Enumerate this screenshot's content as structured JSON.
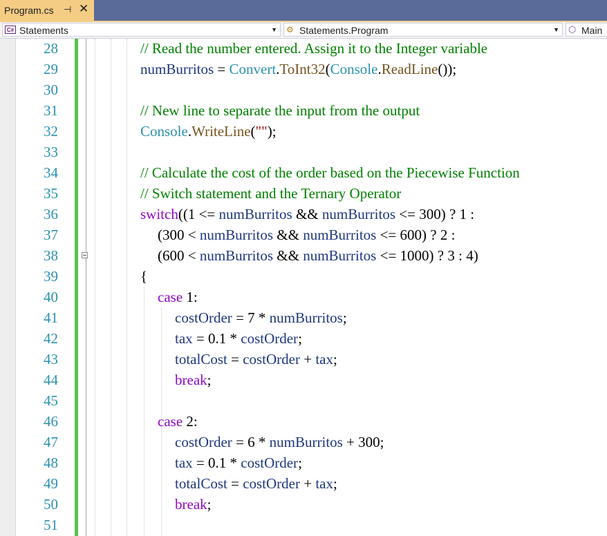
{
  "tab": {
    "title": "Program.cs",
    "pin_glyph": "⊣",
    "close_glyph": "✕"
  },
  "nav": {
    "project": "Statements",
    "type": "Statements.Program",
    "member": "Main"
  },
  "colors": {
    "tab_active": "#f5cc84",
    "tab_strip": "#5a6a99",
    "line_number": "#2b91af",
    "comment": "#008000",
    "keyword_control": "#8f08c4",
    "type": "#2b91af",
    "method": "#74531f",
    "string": "#a31515",
    "identifier": "#1f377f",
    "change_bar": "#57c34a"
  },
  "lines": [
    {
      "n": "28",
      "indent": 0,
      "tokens": [
        {
          "t": "// Read the number entered. Assign it to the Integer variable",
          "k": "comment"
        }
      ]
    },
    {
      "n": "29",
      "indent": 0,
      "tokens": [
        {
          "t": "numBurritos",
          "k": "ident"
        },
        {
          "t": " = ",
          "k": "plain"
        },
        {
          "t": "Convert",
          "k": "type"
        },
        {
          "t": ".",
          "k": "plain"
        },
        {
          "t": "ToInt32",
          "k": "method"
        },
        {
          "t": "(",
          "k": "plain"
        },
        {
          "t": "Console",
          "k": "type"
        },
        {
          "t": ".",
          "k": "plain"
        },
        {
          "t": "ReadLine",
          "k": "method"
        },
        {
          "t": "());",
          "k": "plain"
        }
      ]
    },
    {
      "n": "30",
      "indent": 0,
      "tokens": []
    },
    {
      "n": "31",
      "indent": 0,
      "tokens": [
        {
          "t": "// New line to separate the input from the output",
          "k": "comment"
        }
      ]
    },
    {
      "n": "32",
      "indent": 0,
      "tokens": [
        {
          "t": "Console",
          "k": "type"
        },
        {
          "t": ".",
          "k": "plain"
        },
        {
          "t": "WriteLine",
          "k": "method"
        },
        {
          "t": "(",
          "k": "plain"
        },
        {
          "t": "\"\"",
          "k": "string"
        },
        {
          "t": ");",
          "k": "plain"
        }
      ]
    },
    {
      "n": "33",
      "indent": 0,
      "tokens": []
    },
    {
      "n": "34",
      "indent": 0,
      "tokens": [
        {
          "t": "// Calculate the cost of the order based on the Piecewise Function",
          "k": "comment"
        }
      ]
    },
    {
      "n": "35",
      "indent": 0,
      "tokens": [
        {
          "t": "// Switch statement and the Ternary Operator",
          "k": "comment"
        }
      ]
    },
    {
      "n": "36",
      "indent": 0,
      "tokens": [
        {
          "t": "switch",
          "k": "control"
        },
        {
          "t": "((1 <= ",
          "k": "plain"
        },
        {
          "t": "numBurritos",
          "k": "ident"
        },
        {
          "t": " && ",
          "k": "plain"
        },
        {
          "t": "numBurritos",
          "k": "ident"
        },
        {
          "t": " <= 300) ? 1 :",
          "k": "plain"
        }
      ]
    },
    {
      "n": "37",
      "indent": 1,
      "tokens": [
        {
          "t": "(300 < ",
          "k": "plain"
        },
        {
          "t": "numBurritos",
          "k": "ident"
        },
        {
          "t": " && ",
          "k": "plain"
        },
        {
          "t": "numBurritos",
          "k": "ident"
        },
        {
          "t": " <= 600) ? 2 :",
          "k": "plain"
        }
      ]
    },
    {
      "n": "38",
      "indent": 1,
      "tokens": [
        {
          "t": "(600 < ",
          "k": "plain"
        },
        {
          "t": "numBurritos",
          "k": "ident"
        },
        {
          "t": " && ",
          "k": "plain"
        },
        {
          "t": "numBurritos",
          "k": "ident"
        },
        {
          "t": " <= 1000) ? 3 : 4)",
          "k": "plain"
        }
      ]
    },
    {
      "n": "39",
      "indent": 0,
      "tokens": [
        {
          "t": "{",
          "k": "plain"
        }
      ]
    },
    {
      "n": "40",
      "indent": 1,
      "tokens": [
        {
          "t": "case",
          "k": "control"
        },
        {
          "t": " 1:",
          "k": "plain"
        }
      ]
    },
    {
      "n": "41",
      "indent": 2,
      "tokens": [
        {
          "t": "costOrder",
          "k": "ident"
        },
        {
          "t": " = 7 * ",
          "k": "plain"
        },
        {
          "t": "numBurritos",
          "k": "ident"
        },
        {
          "t": ";",
          "k": "plain"
        }
      ]
    },
    {
      "n": "42",
      "indent": 2,
      "tokens": [
        {
          "t": "tax",
          "k": "ident"
        },
        {
          "t": " = 0.1 * ",
          "k": "plain"
        },
        {
          "t": "costOrder",
          "k": "ident"
        },
        {
          "t": ";",
          "k": "plain"
        }
      ]
    },
    {
      "n": "43",
      "indent": 2,
      "tokens": [
        {
          "t": "totalCost",
          "k": "ident"
        },
        {
          "t": " = ",
          "k": "plain"
        },
        {
          "t": "costOrder",
          "k": "ident"
        },
        {
          "t": " + ",
          "k": "plain"
        },
        {
          "t": "tax",
          "k": "ident"
        },
        {
          "t": ";",
          "k": "plain"
        }
      ]
    },
    {
      "n": "44",
      "indent": 2,
      "tokens": [
        {
          "t": "break",
          "k": "control"
        },
        {
          "t": ";",
          "k": "plain"
        }
      ]
    },
    {
      "n": "45",
      "indent": 0,
      "tokens": []
    },
    {
      "n": "46",
      "indent": 1,
      "tokens": [
        {
          "t": "case",
          "k": "control"
        },
        {
          "t": " 2:",
          "k": "plain"
        }
      ]
    },
    {
      "n": "47",
      "indent": 2,
      "tokens": [
        {
          "t": "costOrder",
          "k": "ident"
        },
        {
          "t": " = 6 * ",
          "k": "plain"
        },
        {
          "t": "numBurritos",
          "k": "ident"
        },
        {
          "t": " + 300;",
          "k": "plain"
        }
      ]
    },
    {
      "n": "48",
      "indent": 2,
      "tokens": [
        {
          "t": "tax",
          "k": "ident"
        },
        {
          "t": " = 0.1 * ",
          "k": "plain"
        },
        {
          "t": "costOrder",
          "k": "ident"
        },
        {
          "t": ";",
          "k": "plain"
        }
      ]
    },
    {
      "n": "49",
      "indent": 2,
      "tokens": [
        {
          "t": "totalCost",
          "k": "ident"
        },
        {
          "t": " = ",
          "k": "plain"
        },
        {
          "t": "costOrder",
          "k": "ident"
        },
        {
          "t": " + ",
          "k": "plain"
        },
        {
          "t": "tax",
          "k": "ident"
        },
        {
          "t": ";",
          "k": "plain"
        }
      ]
    },
    {
      "n": "50",
      "indent": 2,
      "tokens": [
        {
          "t": "break",
          "k": "control"
        },
        {
          "t": ";",
          "k": "plain"
        }
      ]
    },
    {
      "n": "51",
      "indent": 0,
      "tokens": []
    }
  ]
}
